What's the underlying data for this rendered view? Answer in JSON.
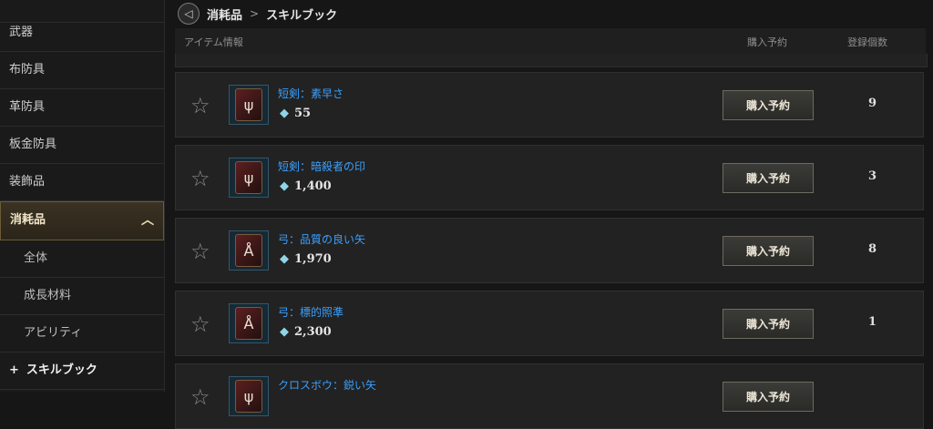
{
  "sidebar": {
    "items": [
      {
        "label": "武器"
      },
      {
        "label": "布防具"
      },
      {
        "label": "革防具"
      },
      {
        "label": "板金防具"
      },
      {
        "label": "装飾品"
      },
      {
        "label": "消耗品",
        "expanded": true
      }
    ],
    "sub_items": [
      {
        "label": "全体"
      },
      {
        "label": "成長材料"
      },
      {
        "label": "アビリティ"
      },
      {
        "label": "スキルブック",
        "current": true
      }
    ]
  },
  "breadcrumb": {
    "category": "消耗品",
    "separator": ">",
    "subcategory": "スキルブック"
  },
  "table": {
    "headers": {
      "info": "アイテム情報",
      "reserve": "購入予約",
      "count": "登録個数"
    },
    "rows": [
      {
        "name": "短剣：素早さ",
        "price": "55",
        "button": "購入予約",
        "count": "9",
        "icon": "skill-book-dagger-icon"
      },
      {
        "name": "短剣：暗殺者の印",
        "price": "1,400",
        "button": "購入予約",
        "count": "3",
        "icon": "skill-book-dagger-icon"
      },
      {
        "name": "弓：品質の良い矢",
        "price": "1,970",
        "button": "購入予約",
        "count": "8",
        "icon": "skill-book-bow-icon"
      },
      {
        "name": "弓：標的照準",
        "price": "2,300",
        "button": "購入予約",
        "count": "1",
        "icon": "skill-book-bow-icon"
      },
      {
        "name": "クロスボウ：鋭い矢",
        "price": "",
        "button": "購入予約",
        "count": "",
        "icon": "skill-book-crossbow-icon"
      }
    ]
  },
  "colors": {
    "link": "#3aa0ff",
    "active_border": "#6b5a38",
    "background": "#161616"
  }
}
